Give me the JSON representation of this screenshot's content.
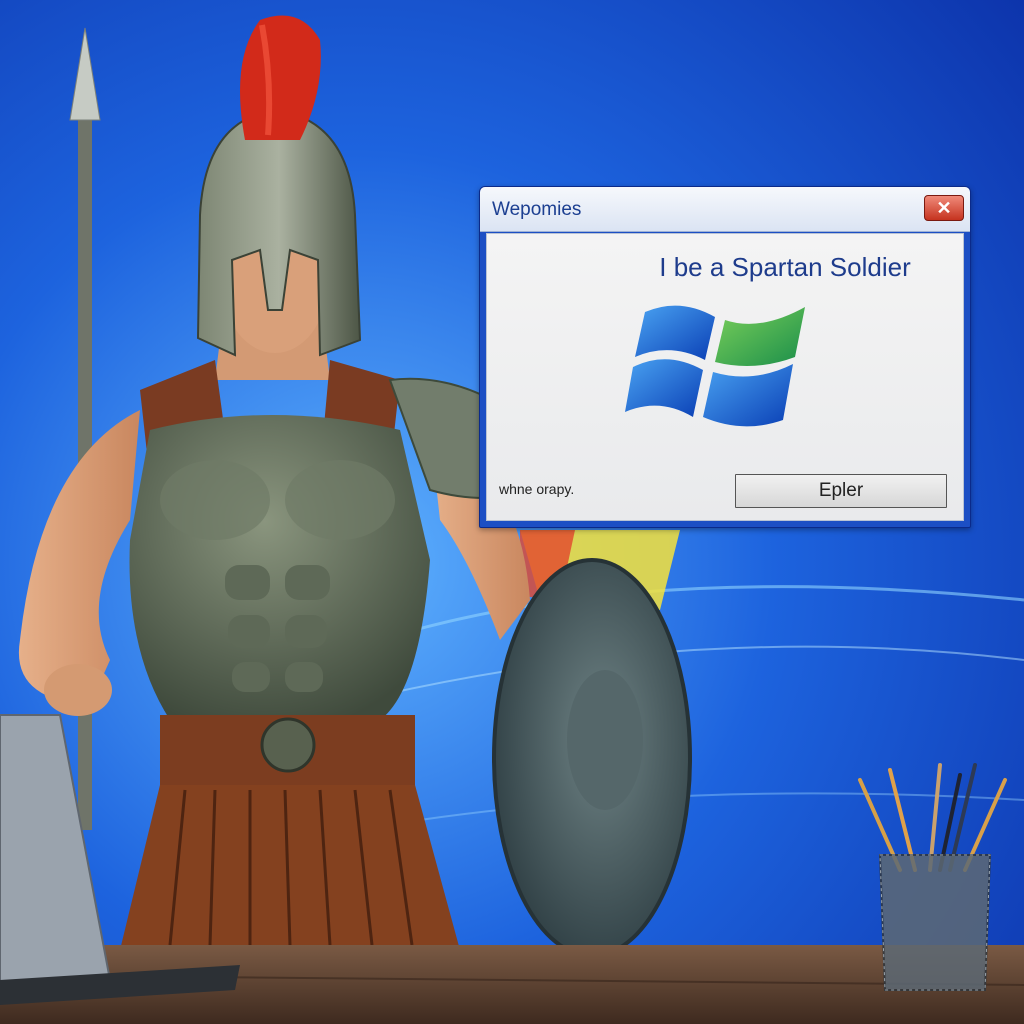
{
  "dialog": {
    "title": "Wepomies",
    "message": "I be a Spartan Soldier",
    "footnote": "whne orapy.",
    "button_label": "Epler"
  },
  "colors": {
    "desktop_blue": "#1a56d8",
    "title_text": "#1c3f91",
    "close_red": "#c5331f",
    "plume_red": "#d22a1a"
  },
  "icons": [
    "close-icon",
    "windows-logo-icon"
  ]
}
